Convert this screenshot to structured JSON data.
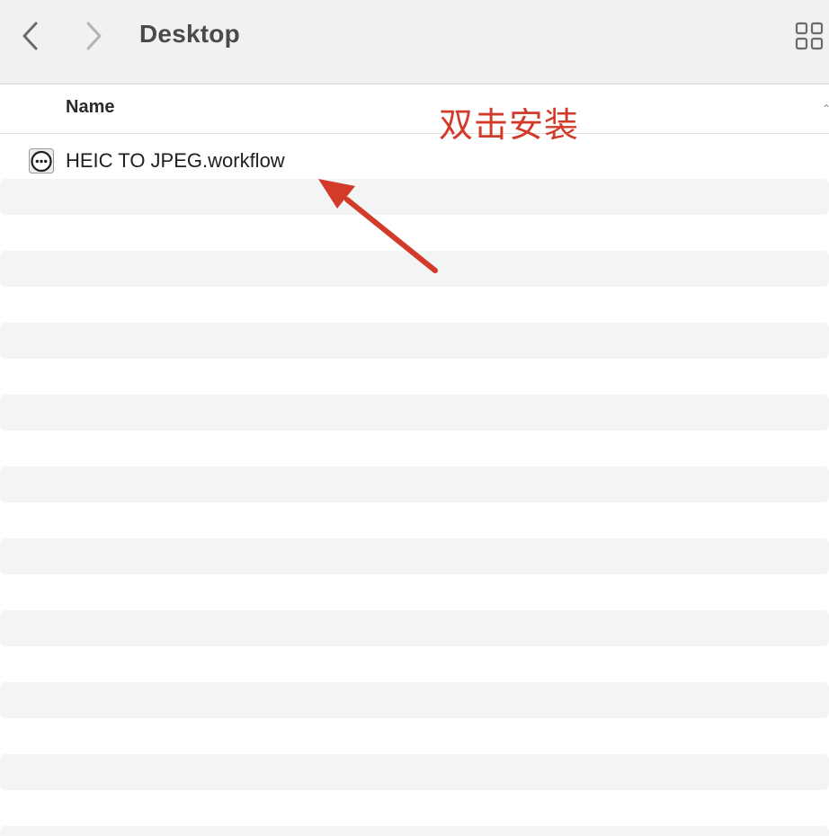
{
  "window": {
    "title": "Desktop"
  },
  "toolbar": {
    "back_icon": "chevron-left-icon",
    "forward_icon": "chevron-right-icon",
    "view_icon": "grid-view-icon"
  },
  "list_header": {
    "name_column": "Name",
    "sort_indicator": "⌃"
  },
  "files": [
    {
      "name": "HEIC TO JPEG.workflow",
      "icon": "automator-workflow-icon"
    }
  ],
  "annotation": {
    "text": "双击安装",
    "color": "#d23a2a"
  }
}
